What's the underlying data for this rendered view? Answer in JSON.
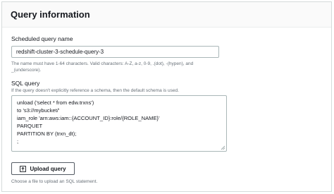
{
  "panel": {
    "title": "Query information"
  },
  "scheduled_query": {
    "label": "Scheduled query name",
    "value": "redshift-cluster-3-schedule-query-3",
    "hint_line1": "The name must have 1-64 characters. Valid characters: A-Z, a-z, 0-9, .(dot), -(hypen), and",
    "hint_line2": "_(underscore)."
  },
  "sql_query": {
    "label": "SQL query",
    "hint": "If the query doesn't explicitly reference a schema, then the default schema is used.",
    "lines": [
      "unload ('select * from edw.trxns')",
      "to 's3://mybucket/'",
      "iam_role 'arn:aws:iam::{ACCOUNT_ID}:role/{ROLE_NAME}'",
      "PARQUET",
      "PARTITION BY (trxn_dt);",
      ";"
    ]
  },
  "upload": {
    "button_label": "Upload query",
    "hint": "Choose a file to upload an SQL statement.",
    "icon": "upload-icon"
  }
}
